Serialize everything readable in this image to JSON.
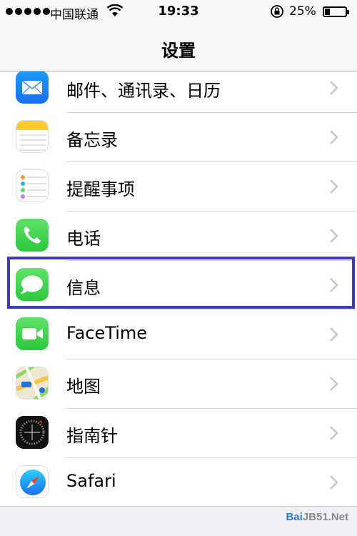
{
  "status_bar": {
    "carrier": "中国联通",
    "time": "19:33",
    "battery_percent": "25%",
    "battery_level": 0.25
  },
  "nav": {
    "title": "设置"
  },
  "rows": [
    {
      "label": "邮件、通讯录、日历",
      "icon": "mail-icon"
    },
    {
      "label": "备忘录",
      "icon": "notes-icon"
    },
    {
      "label": "提醒事项",
      "icon": "reminders-icon"
    },
    {
      "label": "电话",
      "icon": "phone-icon"
    },
    {
      "label": "信息",
      "icon": "messages-icon",
      "highlighted": true
    },
    {
      "label": "FaceTime",
      "icon": "facetime-icon"
    },
    {
      "label": "地图",
      "icon": "maps-icon"
    },
    {
      "label": "指南针",
      "icon": "compass-icon"
    },
    {
      "label": "Safari",
      "icon": "safari-icon"
    }
  ],
  "colors": {
    "highlight_border": "#3c3cb4",
    "chevron": "#c7c7cc"
  },
  "watermark": {
    "prefix": "Bai",
    "suffix": "JB51.Net"
  }
}
